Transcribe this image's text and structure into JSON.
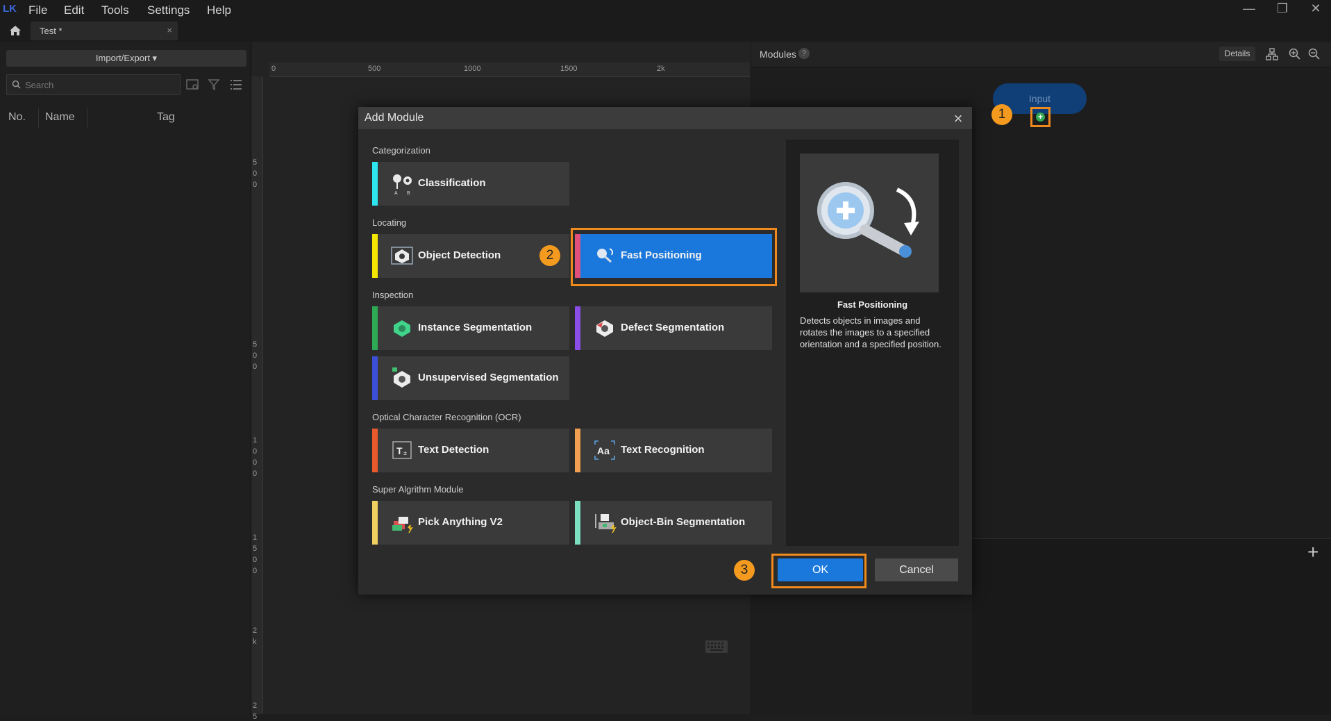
{
  "app": {
    "logo_text": "LK",
    "menu": [
      "File",
      "Edit",
      "Tools",
      "Settings",
      "Help"
    ],
    "window_controls": [
      "—",
      "❐",
      "✕"
    ]
  },
  "tab": {
    "title": "Test *",
    "close": "×"
  },
  "left_panel": {
    "import_export": "Import/Export ▾",
    "search_placeholder": "Search",
    "columns": [
      "No.",
      "Name",
      "Tag"
    ]
  },
  "canvas": {
    "ruler_ticks": [
      "0",
      "500",
      "1000",
      "1500",
      "2k"
    ],
    "v_ruler_ticks": [
      "5",
      "0",
      "0",
      "5",
      "0",
      "0",
      "1",
      "0",
      "0",
      "0",
      "1",
      "5",
      "0",
      "0",
      "2",
      "k",
      "2",
      "5"
    ]
  },
  "modules_panel": {
    "title": "Modules",
    "help": "?",
    "details": "Details",
    "input_node": "Input",
    "add_symbol": "+",
    "add_panel_plus": "+"
  },
  "steps": [
    "1",
    "2",
    "3"
  ],
  "dialog": {
    "title": "Add Module",
    "close": "×",
    "sections": [
      {
        "label": "Categorization",
        "cards": [
          {
            "label": "Classification",
            "color": "#2ee6f0",
            "icon": "classification-icon"
          }
        ]
      },
      {
        "label": "Locating",
        "cards": [
          {
            "label": "Object Detection",
            "color": "#f5e600",
            "icon": "object-detection-icon"
          },
          {
            "label": "Fast Positioning",
            "color": "#e0507a",
            "icon": "fast-positioning-icon",
            "selected": true
          }
        ]
      },
      {
        "label": "Inspection",
        "cards": [
          {
            "label": "Instance Segmentation",
            "color": "#2eaa55",
            "icon": "instance-segmentation-icon"
          },
          {
            "label": "Defect Segmentation",
            "color": "#8a4de8",
            "icon": "defect-segmentation-icon"
          },
          {
            "label": "Unsupervised Segmentation",
            "color": "#3b4fd8",
            "icon": "unsupervised-segmentation-icon"
          }
        ]
      },
      {
        "label": "Optical Character Recognition (OCR)",
        "cards": [
          {
            "label": "Text Detection",
            "color": "#e85a2c",
            "icon": "text-detection-icon"
          },
          {
            "label": "Text Recognition",
            "color": "#f0a050",
            "icon": "text-recognition-icon"
          }
        ]
      },
      {
        "label": "Super Algrithm Module",
        "cards": [
          {
            "label": "Pick Anything V2",
            "color": "#f0d060",
            "icon": "pick-anything-icon"
          },
          {
            "label": "Object-Bin Segmentation",
            "color": "#7be0c0",
            "icon": "object-bin-segmentation-icon"
          }
        ]
      }
    ],
    "preview": {
      "title": "Fast Positioning",
      "description": "Detects objects in images and rotates the images to a specified orientation and a specified position."
    },
    "ok": "OK",
    "cancel": "Cancel"
  }
}
